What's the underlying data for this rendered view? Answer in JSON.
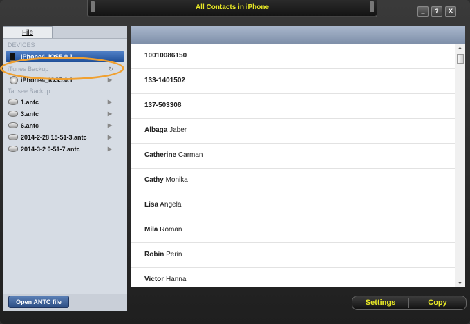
{
  "window": {
    "title": "All Contacts in iPhone"
  },
  "title_buttons": [
    "_",
    "?",
    "X"
  ],
  "menu": {
    "file": "File"
  },
  "left": {
    "devices_label": "DEVICES",
    "itunes_label": "iTunes Backup",
    "tansee_label": "Tansee Backup",
    "selected_device": "iPhone4_iOS5.0.1",
    "itunes_items": [
      {
        "label": "iPhone4_iOS5.0.1"
      }
    ],
    "tansee_items": [
      {
        "label": "1.antc"
      },
      {
        "label": "3.antc"
      },
      {
        "label": "6.antc"
      },
      {
        "label": "2014-2-28 15-51-3.antc"
      },
      {
        "label": "2014-3-2 0-51-7.antc"
      }
    ],
    "open_button": "Open ANTC file"
  },
  "contacts": [
    {
      "first": "10010086150",
      "last": ""
    },
    {
      "first": "133-1401502",
      "last": ""
    },
    {
      "first": "137-503308",
      "last": ""
    },
    {
      "first": "Albaga",
      "last": "Jaber"
    },
    {
      "first": "Catherine",
      "last": "Carman"
    },
    {
      "first": "Cathy",
      "last": "Monika"
    },
    {
      "first": "Lisa",
      "last": "Angela"
    },
    {
      "first": "Mila",
      "last": "Roman"
    },
    {
      "first": "Robin",
      "last": "Perin"
    },
    {
      "first": "Victor",
      "last": "Hanna"
    }
  ],
  "buttons": {
    "settings": "Settings",
    "copy": "Copy"
  },
  "colors": {
    "accent_text": "#e8e826",
    "selection": "#2f5fa8",
    "highlight": "#f0a030"
  }
}
